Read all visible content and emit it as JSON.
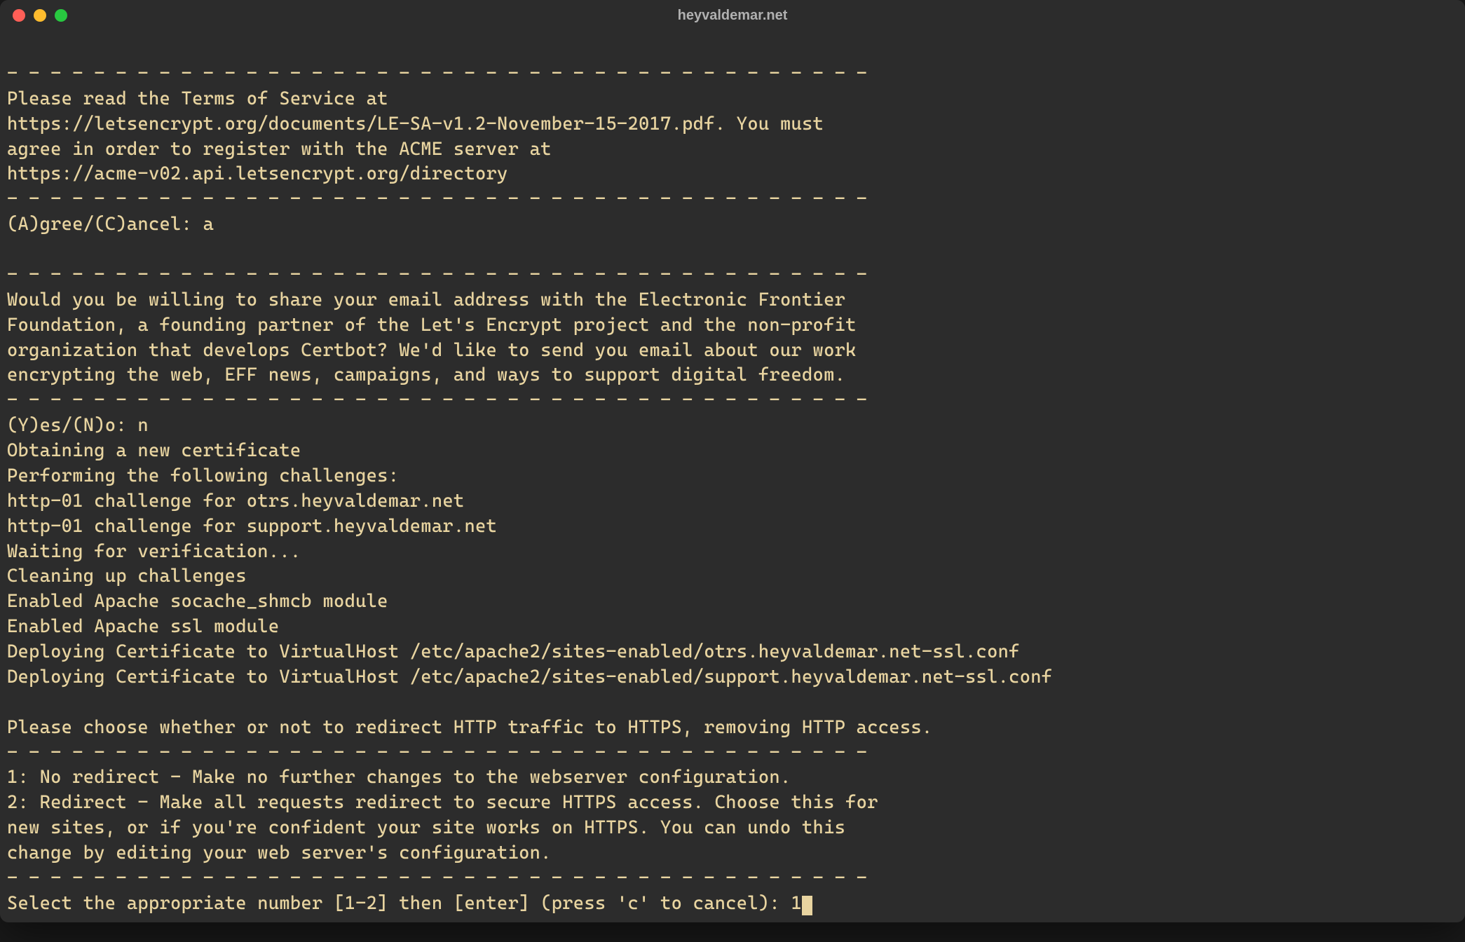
{
  "window": {
    "title": "heyvaldemar.net"
  },
  "terminal": {
    "lines": [
      "",
      "- - - - - - - - - - - - - - - - - - - - - - - - - - - - - - - - - - - - - - - -",
      "Please read the Terms of Service at",
      "https://letsencrypt.org/documents/LE-SA-v1.2-November-15-2017.pdf. You must",
      "agree in order to register with the ACME server at",
      "https://acme-v02.api.letsencrypt.org/directory",
      "- - - - - - - - - - - - - - - - - - - - - - - - - - - - - - - - - - - - - - - -",
      "(A)gree/(C)ancel: a",
      "",
      "- - - - - - - - - - - - - - - - - - - - - - - - - - - - - - - - - - - - - - - -",
      "Would you be willing to share your email address with the Electronic Frontier",
      "Foundation, a founding partner of the Let's Encrypt project and the non-profit",
      "organization that develops Certbot? We'd like to send you email about our work",
      "encrypting the web, EFF news, campaigns, and ways to support digital freedom.",
      "- - - - - - - - - - - - - - - - - - - - - - - - - - - - - - - - - - - - - - - -",
      "(Y)es/(N)o: n",
      "Obtaining a new certificate",
      "Performing the following challenges:",
      "http-01 challenge for otrs.heyvaldemar.net",
      "http-01 challenge for support.heyvaldemar.net",
      "Waiting for verification...",
      "Cleaning up challenges",
      "Enabled Apache socache_shmcb module",
      "Enabled Apache ssl module",
      "Deploying Certificate to VirtualHost /etc/apache2/sites-enabled/otrs.heyvaldemar.net-ssl.conf",
      "Deploying Certificate to VirtualHost /etc/apache2/sites-enabled/support.heyvaldemar.net-ssl.conf",
      "",
      "Please choose whether or not to redirect HTTP traffic to HTTPS, removing HTTP access.",
      "- - - - - - - - - - - - - - - - - - - - - - - - - - - - - - - - - - - - - - - -",
      "1: No redirect - Make no further changes to the webserver configuration.",
      "2: Redirect - Make all requests redirect to secure HTTPS access. Choose this for",
      "new sites, or if you're confident your site works on HTTPS. You can undo this",
      "change by editing your web server's configuration.",
      "- - - - - - - - - - - - - - - - - - - - - - - - - - - - - - - - - - - - - - - -"
    ],
    "prompt": "Select the appropriate number [1-2] then [enter] (press 'c' to cancel): ",
    "input_value": "1"
  }
}
